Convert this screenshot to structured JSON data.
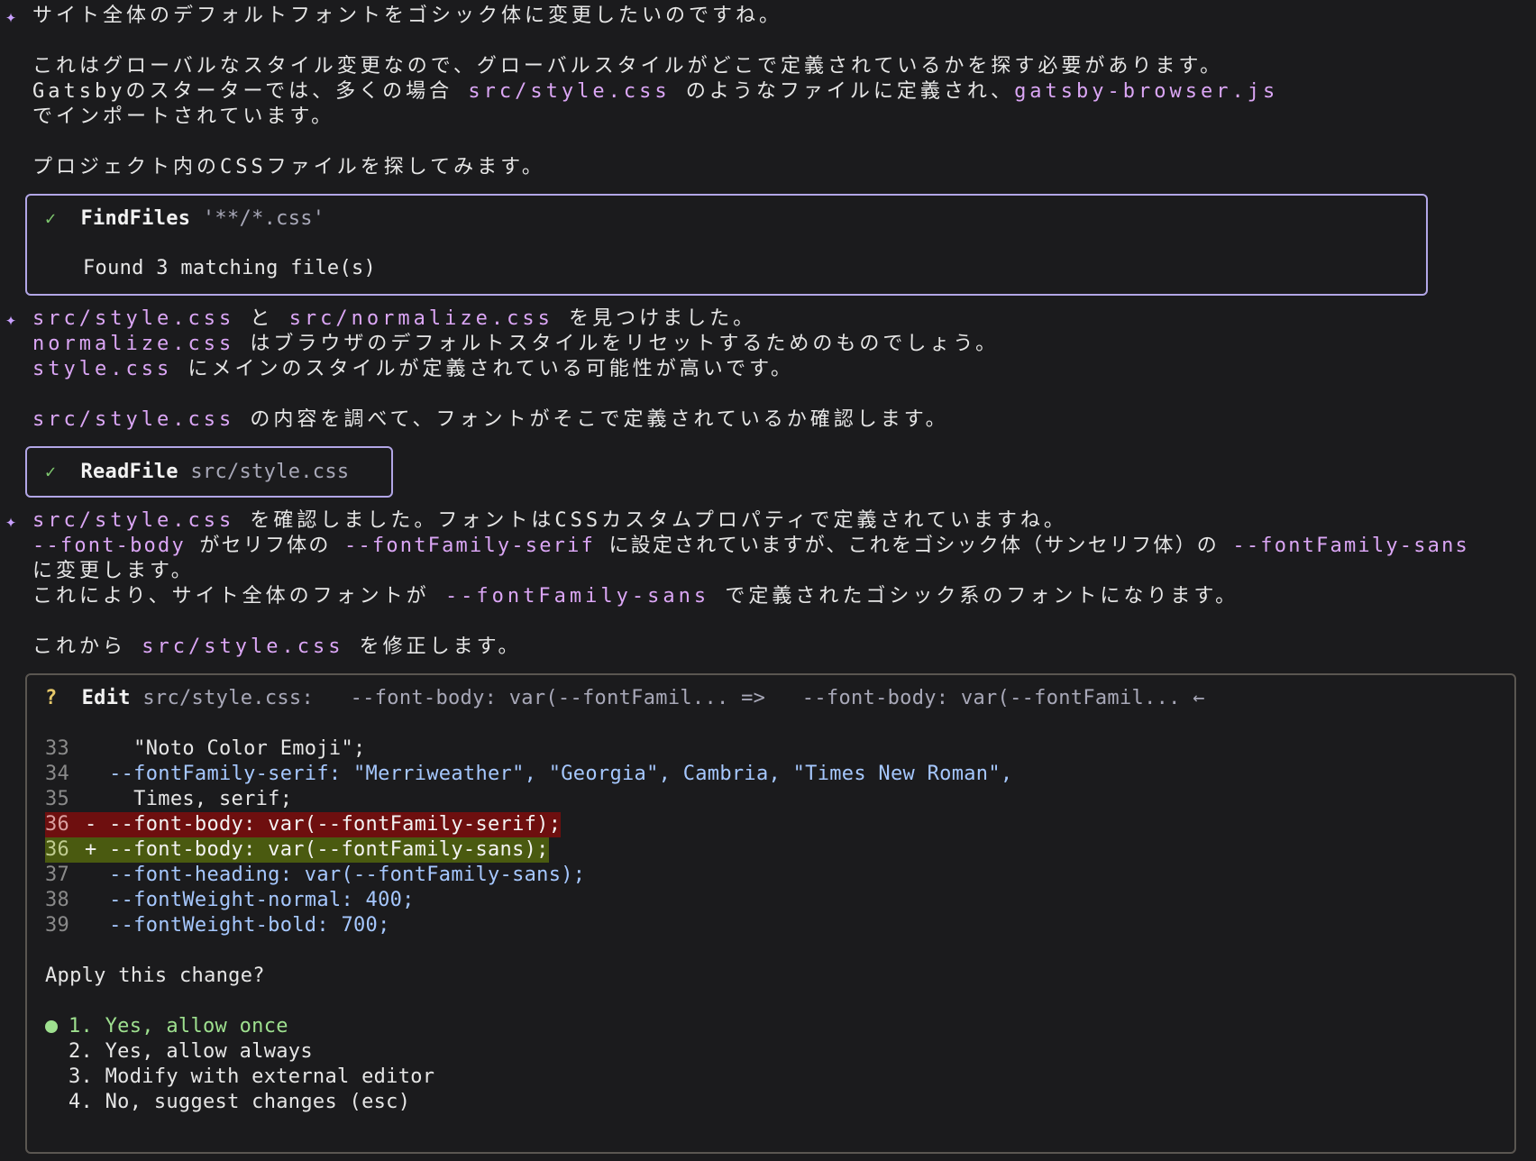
{
  "messages": {
    "m1_line1": "サイト全体のデフォルトフォントをゴシック体に変更したいのですね。",
    "m1_line2": "これはグローバルなスタイル変更なので、グローバルスタイルがどこで定義されているかを探す必要があります。",
    "m1_line3_a": "Gatsbyのスターターでは、多くの場合 ",
    "m1_line3_code1": "src/style.css",
    "m1_line3_b": " のようなファイルに定義され、",
    "m1_line3_code2": "gatsby-browser.js",
    "m1_line4": "でインポートされています。",
    "m1_line5": "プロジェクト内のCSSファイルを探してみます。",
    "m2_code1": "src/style.css",
    "m2_a": " と ",
    "m2_code2": "src/normalize.css",
    "m2_b": " を見つけました。",
    "m2_l2_code": "normalize.css",
    "m2_l2_text": " はブラウザのデフォルトスタイルをリセットするためのものでしょう。",
    "m2_l3_code": "style.css",
    "m2_l3_text": " にメインのスタイルが定義されている可能性が高いです。",
    "m2_l4_code": "src/style.css",
    "m2_l4_text": " の内容を調べて、フォントがそこで定義されているか確認します。",
    "m3_code1": "src/style.css",
    "m3_text1": " を確認しました。フォントはCSSカスタムプロパティで定義されていますね。",
    "m3_l2_code1": "--font-body",
    "m3_l2_a": " がセリフ体の ",
    "m3_l2_code2": "--fontFamily-serif",
    "m3_l2_b": " に設定されていますが、これをゴシック体（サンセリフ体）の ",
    "m3_l2_code3": "--fontFamily-sans",
    "m3_l3": "に変更します。",
    "m3_l4_a": "これにより、サイト全体のフォントが ",
    "m3_l4_code": "--fontFamily-sans",
    "m3_l4_b": " で定義されたゴシック系のフォントになります。",
    "m3_l5_a": "これから ",
    "m3_l5_code": "src/style.css",
    "m3_l5_b": " を修正します。"
  },
  "tools": {
    "findfiles": {
      "check": "✓",
      "name": "FindFiles",
      "arg": " '**/*.css'",
      "result": "Found 3 matching file(s)"
    },
    "readfile": {
      "check": "✓",
      "name": "ReadFile",
      "arg": " src/style.css"
    }
  },
  "edit": {
    "marker": "?",
    "title": "Edit",
    "summary": " src/style.css:   --font-body: var(--fontFamil... =>   --font-body: var(--fontFamil... ←",
    "lines": [
      {
        "num": "33",
        "text": "    \"Noto Color Emoji\";"
      },
      {
        "num": "34",
        "text": "  --fontFamily-serif: \"Merriweather\", \"Georgia\", Cambria, \"Times New Roman\","
      },
      {
        "num": "35",
        "text": "    Times, serif;"
      },
      {
        "num": "36",
        "text": "- --font-body: var(--fontFamily-serif);"
      },
      {
        "num": "36",
        "text": "+ --font-body: var(--fontFamily-sans);"
      },
      {
        "num": "37",
        "text": "  --font-heading: var(--fontFamily-sans);"
      },
      {
        "num": "38",
        "text": "  --fontWeight-normal: 400;"
      },
      {
        "num": "39",
        "text": "  --fontWeight-bold: 700;"
      }
    ],
    "prompt": "Apply this change?",
    "options": [
      "1. Yes, allow once",
      "2. Yes, allow always",
      "3. Modify with external editor",
      "4. No, suggest changes (esc)"
    ]
  },
  "colors": {
    "background": "#1b1b1d",
    "code_accent": "#dba6f5",
    "tool_border": "#b2a6e6",
    "diff_removed": "#6e0f0f",
    "diff_added": "#4a5a10",
    "selected_option": "#9ee08f"
  },
  "icons": {
    "sparkle": "✦",
    "check": "check-icon",
    "bullet": "selected-dot-icon"
  }
}
